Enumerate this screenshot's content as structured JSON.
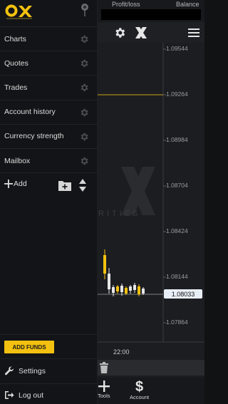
{
  "header": {
    "profit_loss_label": "Profit/loss",
    "balance_label": "Balance"
  },
  "toolbar": {
    "icons": [
      "gear-icon",
      "ox-logo-icon",
      "hamburger-menu-icon"
    ]
  },
  "chart": {
    "price_ticks": [
      "1.09544",
      "1.09264",
      "1.08984",
      "1.08704",
      "1.08424",
      "1.08144",
      "1.07864"
    ],
    "current_price": "1.08033",
    "time_tick": "22:00",
    "watermark_text": "RITIES",
    "colors": {
      "up": "#f3c10f",
      "down": "#e6e6e6",
      "level_line": "#c7a414",
      "accent": "#f3c10f"
    }
  },
  "drawer": {
    "menu_items": [
      {
        "label": "Charts"
      },
      {
        "label": "Quotes"
      },
      {
        "label": "Trades"
      },
      {
        "label": "Account history"
      },
      {
        "label": "Currency strength"
      },
      {
        "label": "Mailbox"
      }
    ],
    "add_label": "Add",
    "add_funds_label": "ADD FUNDS",
    "settings_label": "Settings",
    "logout_label": "Log out"
  },
  "bottom_nav": {
    "tools_label": "Tools",
    "account_label": "Account"
  }
}
